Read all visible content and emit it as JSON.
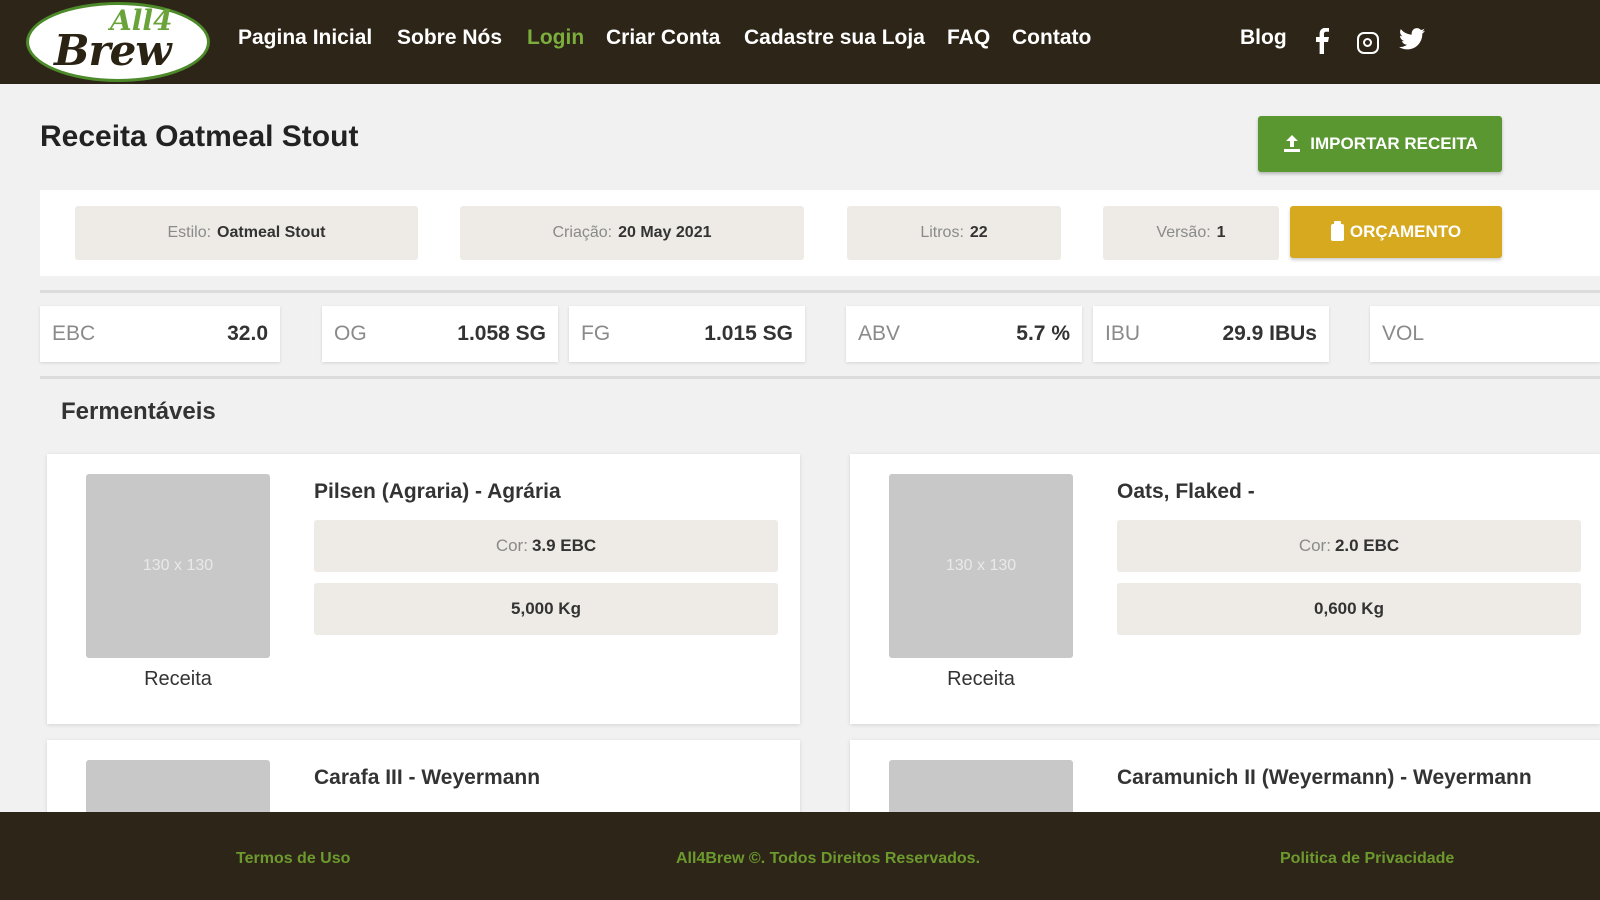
{
  "brand": {
    "logo_top": "All4",
    "logo_bottom": "Brew"
  },
  "nav": {
    "items": [
      {
        "label": "Pagina Inicial"
      },
      {
        "label": "Sobre Nós"
      },
      {
        "label": "Login"
      },
      {
        "label": "Criar Conta"
      },
      {
        "label": "Cadastre sua Loja"
      },
      {
        "label": "FAQ"
      },
      {
        "label": "Contato"
      }
    ],
    "active": "Login",
    "blog_label": "Blog",
    "social_icons": [
      "facebook-icon",
      "instagram-icon",
      "twitter-icon"
    ],
    "active_color": "#7cae3d"
  },
  "header": {
    "title_prefix": "Receita",
    "title_name": "Oatmeal Stout",
    "import_label": "IMPORTAR RECEITA",
    "import_icon": "upload-icon",
    "import_color": "#5a9731"
  },
  "info": {
    "estilo_label": "Estilo:",
    "estilo_value": "Oatmeal Stout",
    "criacao_label": "Criação:",
    "criacao_value": "20 May 2021",
    "litros_label": "Litros:",
    "litros_value": "22",
    "versao_label": "Versão:",
    "versao_value": "1",
    "orcamento_label": "ORÇAMENTO",
    "orcamento_icon": "clipboard-icon",
    "orcamento_color": "#d6a91e"
  },
  "stats": [
    {
      "label": "EBC",
      "value": "32.0"
    },
    {
      "label": "OG",
      "value": "1.058 SG"
    },
    {
      "label": "FG",
      "value": "1.015 SG"
    },
    {
      "label": "ABV",
      "value": "5.7 %"
    },
    {
      "label": "IBU",
      "value": "29.9 IBUs"
    },
    {
      "label": "VOL",
      "value": ""
    }
  ],
  "fermentables": {
    "title": "Fermentáveis",
    "placeholder_text": "130 x 130",
    "thumb_caption": "Receita",
    "color_label": "Cor:",
    "items": [
      {
        "name": "Pilsen (Agraria) - Agrária",
        "color": "3.9 EBC",
        "amount": "5,000 Kg"
      },
      {
        "name": "Oats, Flaked -",
        "color": "2.0 EBC",
        "amount": "0,600 Kg"
      },
      {
        "name": "Carafa III - Weyermann"
      },
      {
        "name": "Caramunich II (Weyermann) - Weyermann"
      }
    ]
  },
  "footer": {
    "terms": "Termos de Uso",
    "copyright": "All4Brew ©. Todos Direitos Reservados.",
    "privacy": "Politica de Privacidade",
    "link_color": "#6c9a2e"
  }
}
